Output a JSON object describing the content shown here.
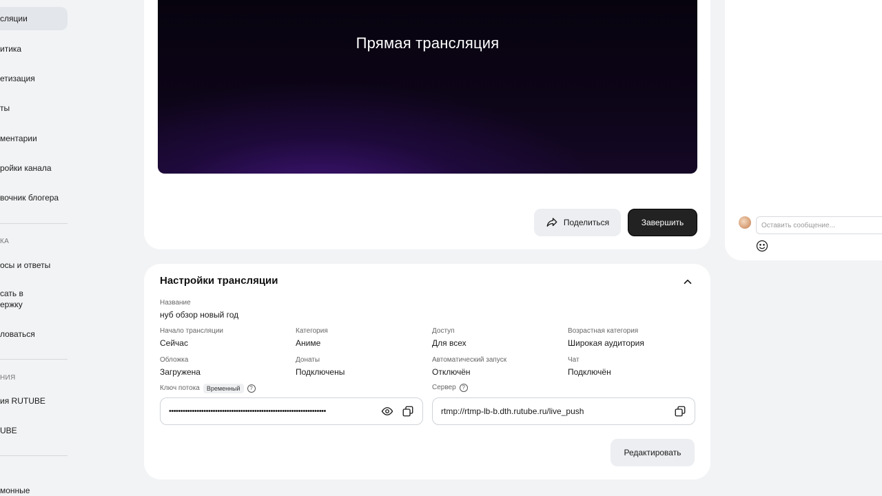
{
  "sidebar": {
    "items": [
      {
        "label": "сляции"
      },
      {
        "label": "итика"
      },
      {
        "label": "етизация"
      },
      {
        "label": "ты"
      },
      {
        "label": "ментарии"
      },
      {
        "label": "ройки канала"
      },
      {
        "label": "вочник блогера"
      }
    ],
    "section1": "КА",
    "items2": [
      {
        "label": "осы и ответы"
      },
      {
        "label1": "сать в",
        "label2": "ержку"
      },
      {
        "label": "ловаться"
      }
    ],
    "section2": "НИЯ",
    "items3": [
      {
        "label": "ия RUTUBE"
      },
      {
        "label": "UBE"
      }
    ],
    "bottom_item": "монные"
  },
  "player": {
    "title": "Прямая трансляция",
    "share_label": "Поделиться",
    "finish_label": "Завершить"
  },
  "settings": {
    "title": "Настройки трансляции",
    "name_label": "Название",
    "name_value": "нуб обзор новый год",
    "start_label": "Начало трансляции",
    "start_value": "Сейчас",
    "category_label": "Категория",
    "category_value": "Аниме",
    "access_label": "Доступ",
    "access_value": "Для всех",
    "age_label": "Возрастная категория",
    "age_value": "Широкая аудитория",
    "cover_label": "Обложка",
    "cover_value": "Загружена",
    "donations_label": "Донаты",
    "donations_value": "Подключены",
    "autostart_label": "Автоматический запуск",
    "autostart_value": "Отключён",
    "chat_label": "Чат",
    "chat_value": "Подключён",
    "stream_key_label": "Ключ потока",
    "stream_key_badge": "Временный",
    "stream_key_value": "••••••••••••••••••••••••••••••••••••••••••••••••••••••••••••••••••••",
    "server_label": "Сервер",
    "server_value": "rtmp://rtmp-lb-b.dth.rutube.ru/live_push",
    "edit_label": "Редактировать"
  },
  "chat": {
    "placeholder": "Оставить сообщение..."
  }
}
